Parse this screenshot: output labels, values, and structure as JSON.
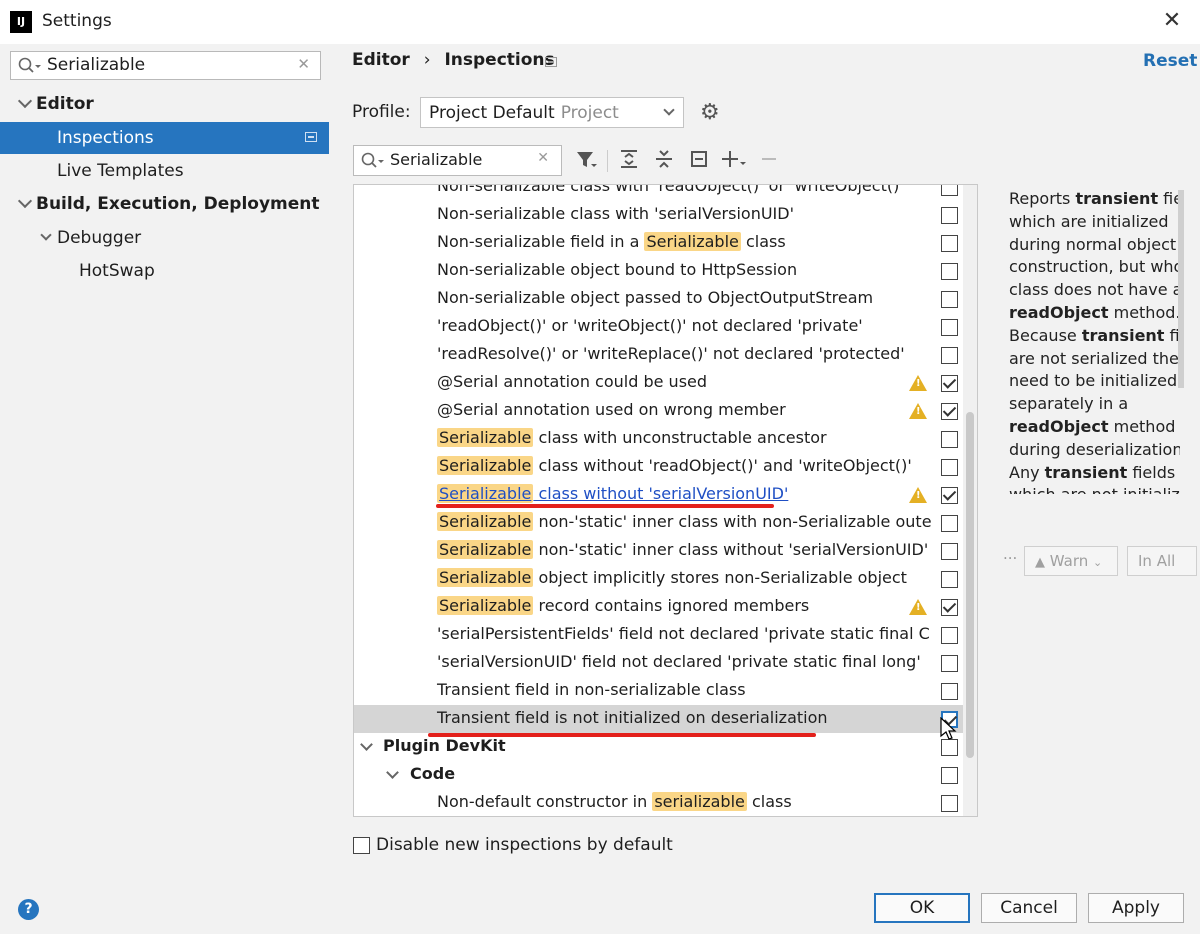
{
  "window": {
    "title": "Settings",
    "logo_text": "IJ"
  },
  "left": {
    "search_value": "Serializable",
    "tree": [
      {
        "label": "Editor"
      },
      {
        "label": "Inspections"
      },
      {
        "label": "Live Templates"
      },
      {
        "label": "Build, Execution, Deployment"
      },
      {
        "label": "Debugger"
      },
      {
        "label": "HotSwap"
      }
    ]
  },
  "header": {
    "breadcrumb_root": "Editor",
    "breadcrumb_sep": "›",
    "breadcrumb_current": "Inspections",
    "reset_label": "Reset",
    "profile_label": "Profile:",
    "profile_value": "Project Default",
    "profile_sub": "Project"
  },
  "filter": {
    "value": "Serializable"
  },
  "inspections": [
    {
      "pre": "",
      "hl": "",
      "text": "Non-serializable class with 'readObject()' or 'writeObject()'",
      "warn": false,
      "checked": false
    },
    {
      "pre": "",
      "hl": "",
      "text": "Non-serializable class with 'serialVersionUID'",
      "warn": false,
      "checked": false
    },
    {
      "pre": "Non-serializable field in a ",
      "hl": "Serializable",
      "text": " class",
      "warn": false,
      "checked": false
    },
    {
      "pre": "",
      "hl": "",
      "text": "Non-serializable object bound to HttpSession",
      "warn": false,
      "checked": false
    },
    {
      "pre": "",
      "hl": "",
      "text": "Non-serializable object passed to ObjectOutputStream",
      "warn": false,
      "checked": false
    },
    {
      "pre": "",
      "hl": "",
      "text": "'readObject()' or 'writeObject()' not declared 'private'",
      "warn": false,
      "checked": false
    },
    {
      "pre": "",
      "hl": "",
      "text": "'readResolve()' or 'writeReplace()' not declared 'protected'",
      "warn": false,
      "checked": false
    },
    {
      "pre": "",
      "hl": "",
      "text": "@Serial annotation could be used",
      "warn": true,
      "checked": true
    },
    {
      "pre": "",
      "hl": "",
      "text": "@Serial annotation used on wrong member",
      "warn": true,
      "checked": true
    },
    {
      "pre": "",
      "hl": "Serializable",
      "text": " class with unconstructable ancestor",
      "warn": false,
      "checked": false
    },
    {
      "pre": "",
      "hl": "Serializable",
      "text": " class without 'readObject()' and 'writeObject()'",
      "warn": false,
      "checked": false
    },
    {
      "pre": "",
      "hl": "Serializable",
      "text": " class without 'serialVersionUID'",
      "warn": true,
      "checked": true,
      "link": true
    },
    {
      "pre": "",
      "hl": "Serializable",
      "text": " non-'static' inner class with non-Serializable oute",
      "warn": false,
      "checked": false
    },
    {
      "pre": "",
      "hl": "Serializable",
      "text": " non-'static' inner class without 'serialVersionUID'",
      "warn": false,
      "checked": false
    },
    {
      "pre": "",
      "hl": "Serializable",
      "text": " object implicitly stores non-Serializable object",
      "warn": false,
      "checked": false
    },
    {
      "pre": "",
      "hl": "Serializable",
      "text": " record contains ignored members",
      "warn": true,
      "checked": true
    },
    {
      "pre": "",
      "hl": "",
      "text": "'serialPersistentFields' field not declared 'private static final C",
      "warn": false,
      "checked": false
    },
    {
      "pre": "",
      "hl": "",
      "text": "'serialVersionUID' field not declared 'private static final long'",
      "warn": false,
      "checked": false
    },
    {
      "pre": "",
      "hl": "",
      "text": "Transient field in non-serializable class",
      "warn": false,
      "checked": false
    },
    {
      "pre": "",
      "hl": "",
      "text": "Transient field is not initialized on deserialization",
      "warn": false,
      "checked": true,
      "selected": true
    }
  ],
  "groups": [
    {
      "label": "Plugin DevKit"
    },
    {
      "label": "Code"
    }
  ],
  "devkit_item": {
    "pre": "Non-default constructor in ",
    "hl": "serializable",
    "text": " class"
  },
  "description": {
    "lines": [
      [
        "Reports ",
        "transient",
        " fiel"
      ],
      [
        "which are initialized"
      ],
      [
        "during normal object"
      ],
      [
        "construction, but whos"
      ],
      [
        "class does not have a"
      ],
      [
        "",
        "readObject",
        " method."
      ],
      [
        "Because ",
        "transient",
        " fiel"
      ],
      [
        "are not serialized they"
      ],
      [
        "need to be initialized"
      ],
      [
        "separately in a"
      ],
      [
        "",
        "readObject",
        " method"
      ],
      [
        "during deserialization."
      ],
      [
        "Any ",
        "transient",
        " fields"
      ],
      [
        "which are not initialize"
      ]
    ]
  },
  "severity": {
    "ellipsis": "...",
    "warning_label": "Warn",
    "scope_label": "In All"
  },
  "footer": {
    "disable_label": "Disable new inspections by default",
    "help_label": "?",
    "ok_label": "OK",
    "cancel_label": "Cancel",
    "apply_label": "Apply"
  }
}
